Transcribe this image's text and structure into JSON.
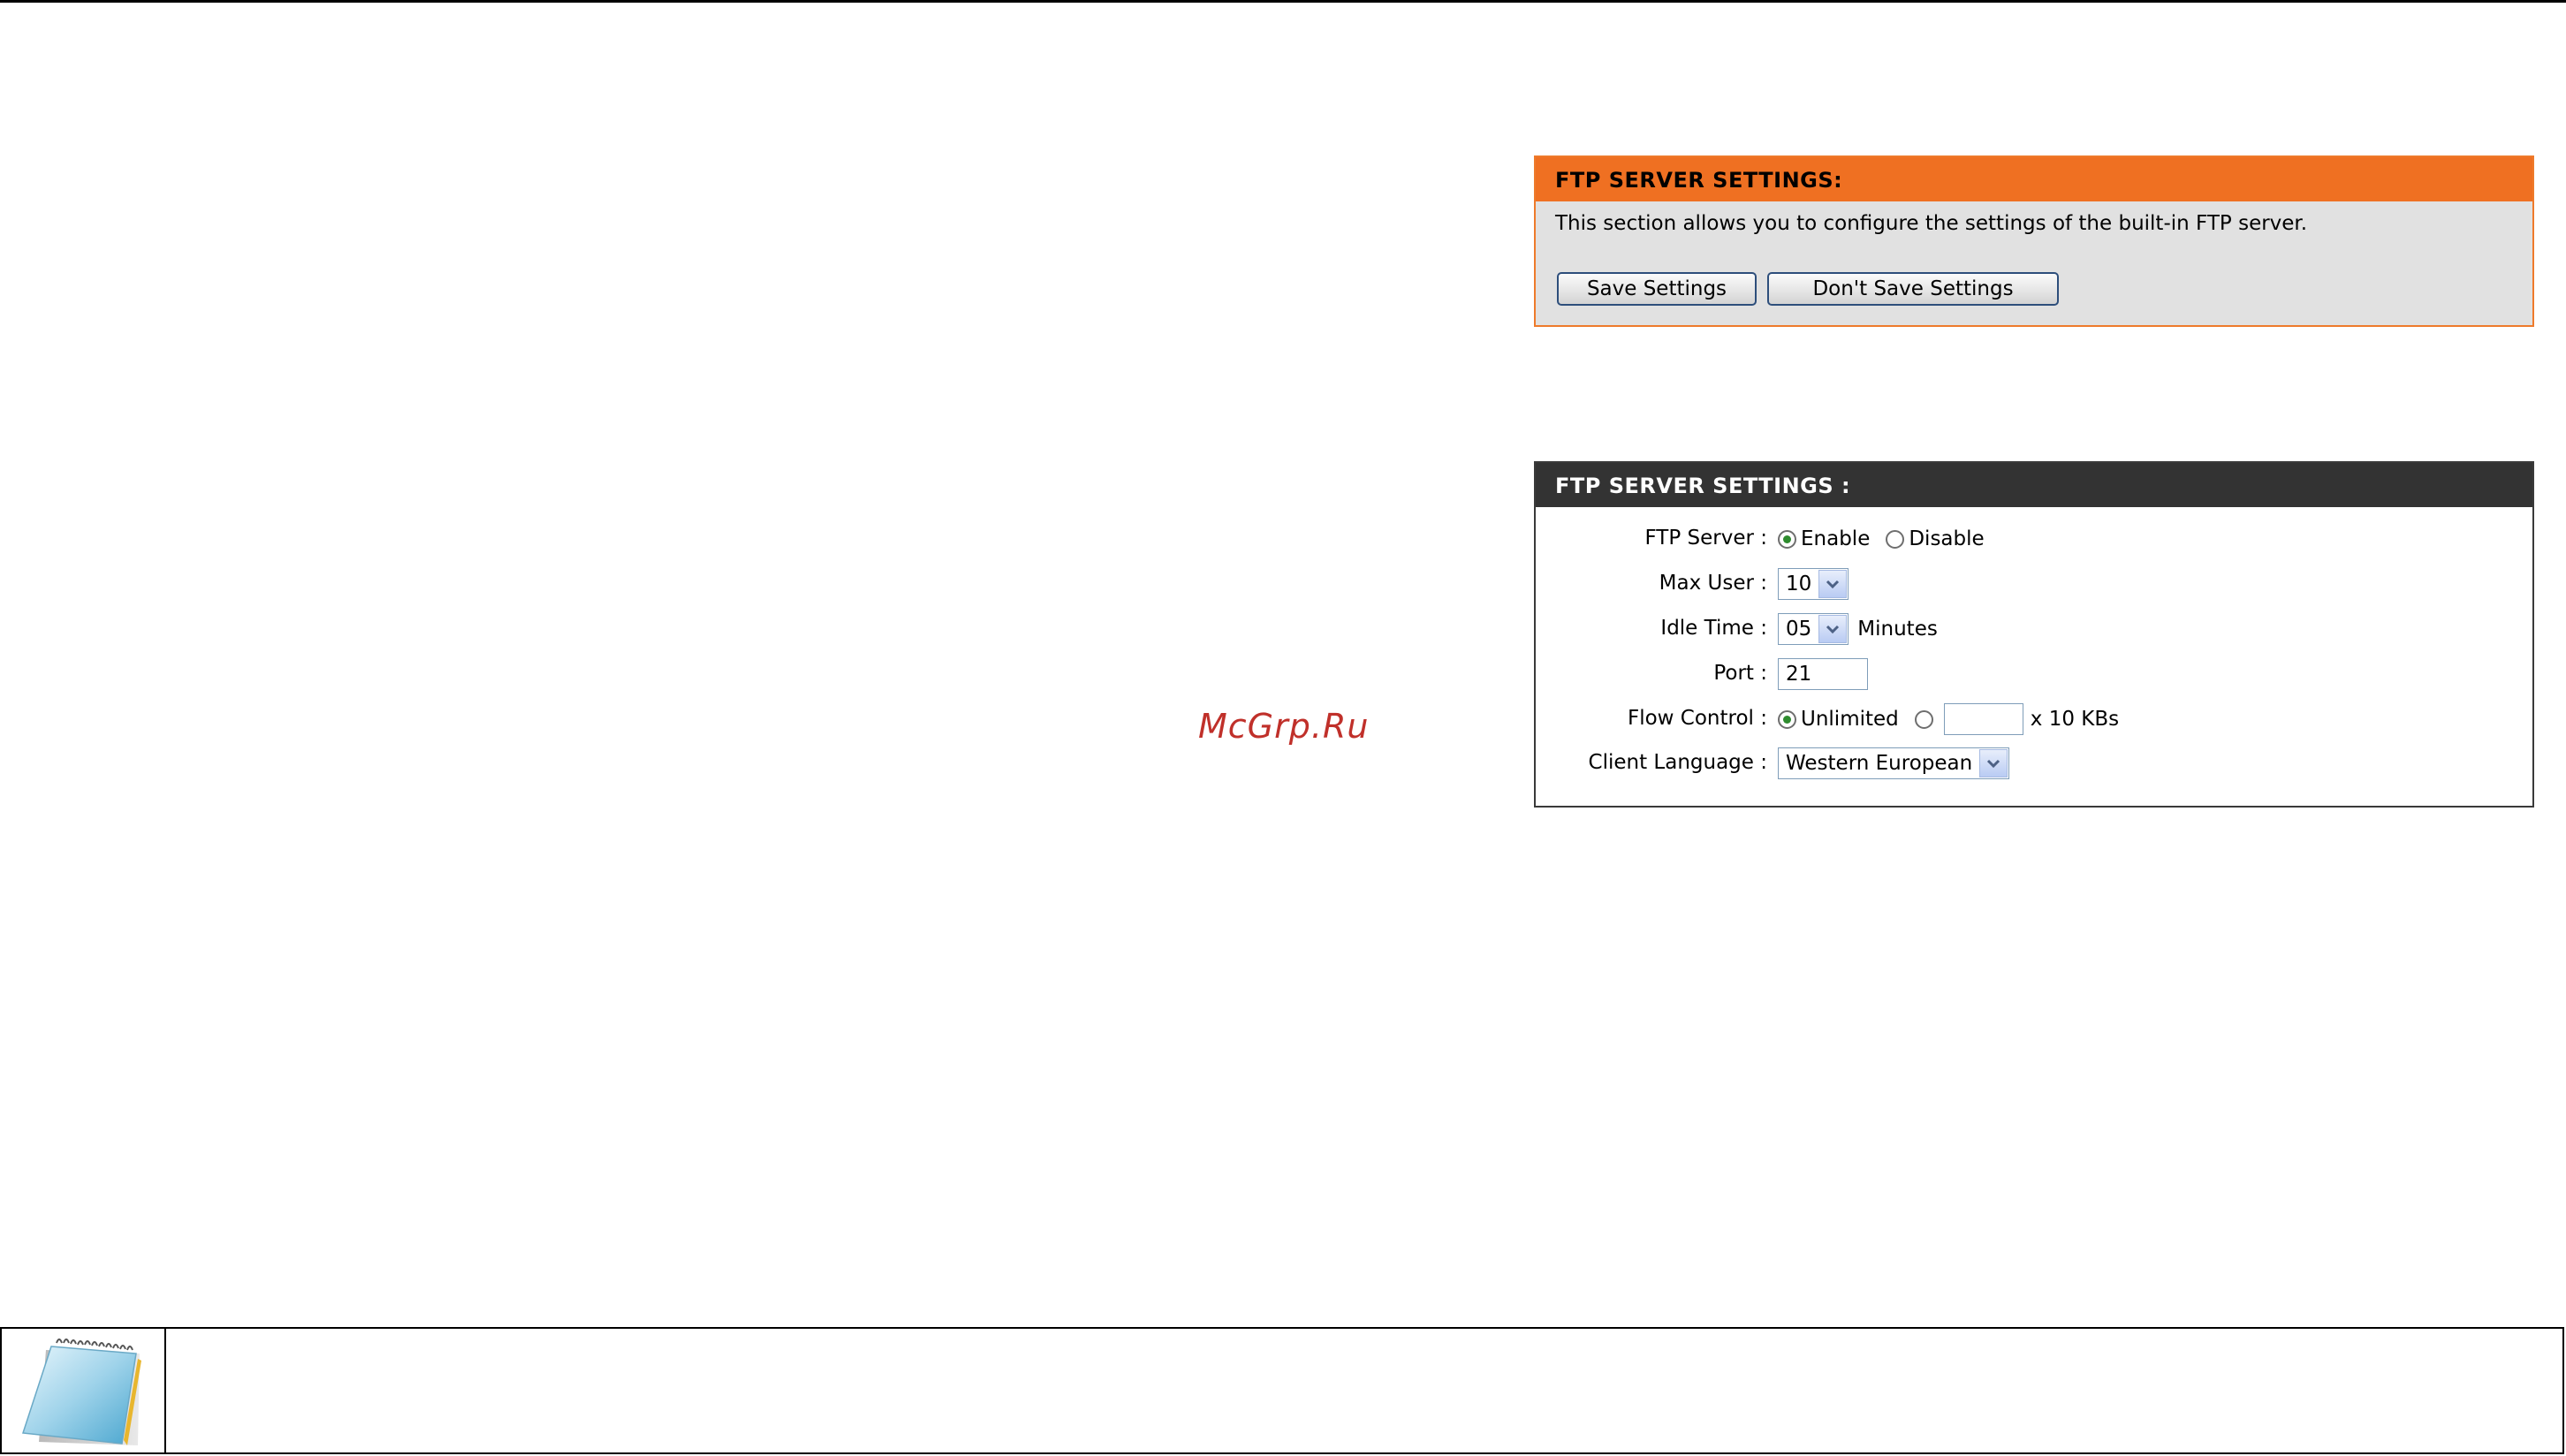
{
  "watermark": "McGrp.Ru",
  "panel_intro": {
    "title": "FTP SERVER SETTINGS:",
    "description": "This section allows you to configure the settings of the built-in FTP server.",
    "save_label": "Save Settings",
    "dont_save_label": "Don't Save Settings",
    "accent_color": "#ef7022"
  },
  "panel_settings": {
    "title": "FTP SERVER SETTINGS :",
    "header_color": "#333333",
    "ftp_server": {
      "label": "FTP Server :",
      "options": [
        "Enable",
        "Disable"
      ],
      "selected": "Enable"
    },
    "max_user": {
      "label": "Max User :",
      "value": "10"
    },
    "idle_time": {
      "label": "Idle Time :",
      "value": "05",
      "unit": "Minutes"
    },
    "port": {
      "label": "Port :",
      "value": "21"
    },
    "flow_control": {
      "label": "Flow Control :",
      "option_unlimited": "Unlimited",
      "selected": "Unlimited",
      "custom_value": "",
      "unit": "x 10 KBs"
    },
    "client_language": {
      "label": "Client Language :",
      "value": "Western European"
    }
  },
  "note": {
    "icon": "notepad-icon",
    "text": ""
  }
}
